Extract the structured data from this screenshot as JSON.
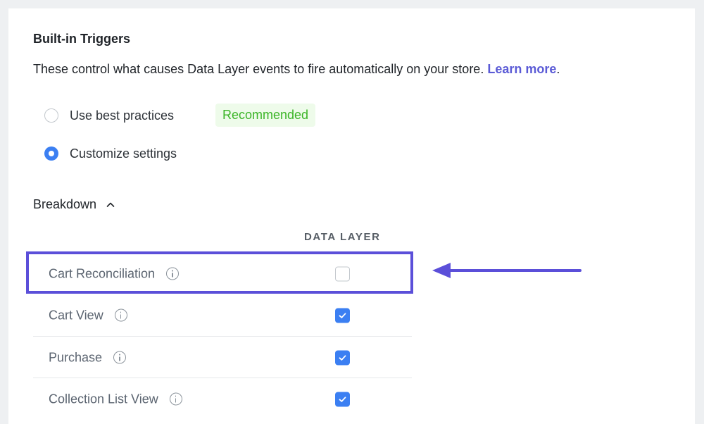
{
  "section": {
    "title": "Built-in Triggers",
    "description": "These control what causes Data Layer events to fire automatically on your store.",
    "learn_more": "Learn more",
    "period": "."
  },
  "options": [
    {
      "label": "Use best practices",
      "selected": false,
      "badge": "Recommended"
    },
    {
      "label": "Customize settings",
      "selected": true
    }
  ],
  "breakdown": {
    "label": "Breakdown",
    "expanded": true,
    "column_header": "DATA LAYER",
    "rows": [
      {
        "label": "Cart Reconciliation",
        "checked": false,
        "highlighted": true
      },
      {
        "label": "Cart View",
        "checked": true
      },
      {
        "label": "Purchase",
        "checked": true
      },
      {
        "label": "Collection List View",
        "checked": true
      }
    ]
  },
  "colors": {
    "accent": "#3b7ff2",
    "link": "#5b5bd6",
    "badge_text": "#3cb528",
    "badge_bg": "#eefbea",
    "annotation": "#5b4fd9"
  }
}
